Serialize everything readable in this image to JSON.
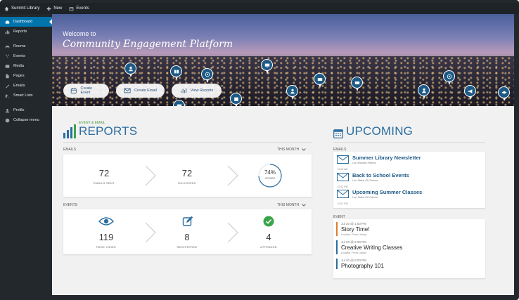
{
  "adminbar": {
    "site": "Summit Library",
    "new_label": "New",
    "events_label": "Events"
  },
  "sidebar": {
    "items": [
      {
        "label": "Dashboard",
        "icon": "dashboard-icon"
      },
      {
        "label": "Reports",
        "icon": "reports-icon"
      },
      {
        "label": "Rooms",
        "icon": "rooms-icon"
      },
      {
        "label": "Events",
        "icon": "events-icon"
      },
      {
        "label": "Media",
        "icon": "media-icon"
      },
      {
        "label": "Pages",
        "icon": "pages-icon"
      },
      {
        "label": "Emails",
        "icon": "emails-icon"
      },
      {
        "label": "Smart Lists",
        "icon": "smart-lists-icon"
      },
      {
        "label": "Profile",
        "icon": "profile-icon"
      },
      {
        "label": "Collapse menu",
        "icon": "collapse-icon"
      }
    ]
  },
  "hero": {
    "welcome": "Welcome to",
    "title": "Community Engagement Platform",
    "buttons": [
      {
        "label": "Create Event",
        "icon": "calendar-icon"
      },
      {
        "label": "Create Email",
        "icon": "envelope-icon"
      },
      {
        "label": "View Reports",
        "icon": "bar-chart-icon"
      }
    ]
  },
  "reports": {
    "kicker": "EVENT & EMAIL",
    "title": "REPORTS",
    "emails": {
      "label": "EMAILS",
      "period": "THIS MONTH",
      "sent": "72",
      "sent_label": "EMAILS SENT",
      "delivered": "72",
      "delivered_label": "DELIVERED",
      "opened_pct": "74%",
      "opened_fraction": 0.74,
      "opened_label": "OPENED"
    },
    "events": {
      "label": "EVENTS",
      "period": "THIS MONTH",
      "views": "119",
      "views_label": "PAGE VIEWS",
      "registered": "8",
      "registered_label": "REGISTERED",
      "attended": "4",
      "attended_label": "ATTENDED"
    }
  },
  "upcoming": {
    "title": "UPCOMING",
    "emails_label": "EMAILS",
    "emails": [
      {
        "time": "12:00 AM",
        "title": "Summer Library Newsletter",
        "list": "List: Brandon Patrons"
      },
      {
        "time": "12:01 PM",
        "title": "Back to School Events",
        "list": "List: Status OK Patrons"
      },
      {
        "time": "12:01 PM",
        "title": "Upcoming Summer Classes",
        "list": "List: Status OK Patrons"
      }
    ],
    "event_label": "EVENT",
    "events": [
      {
        "date": "Jul 20 @ 1:00 PM",
        "title": "Story Time!",
        "location": "Location: Provo Library",
        "color": "#e07b2a"
      },
      {
        "date": "Jul 20 @ 2:30 PM",
        "title": "Creative Writing Classes",
        "location": "Location: Provo Library",
        "color": "#2a6ea0"
      },
      {
        "date": "Jul 20 @ 6:00 PM",
        "title": "Photography 101",
        "location": "",
        "color": "#2a6ea0"
      }
    ]
  },
  "colors": {
    "accent": "#0073aa",
    "brand_blue": "#2a6ea0",
    "green": "#3aa548"
  }
}
